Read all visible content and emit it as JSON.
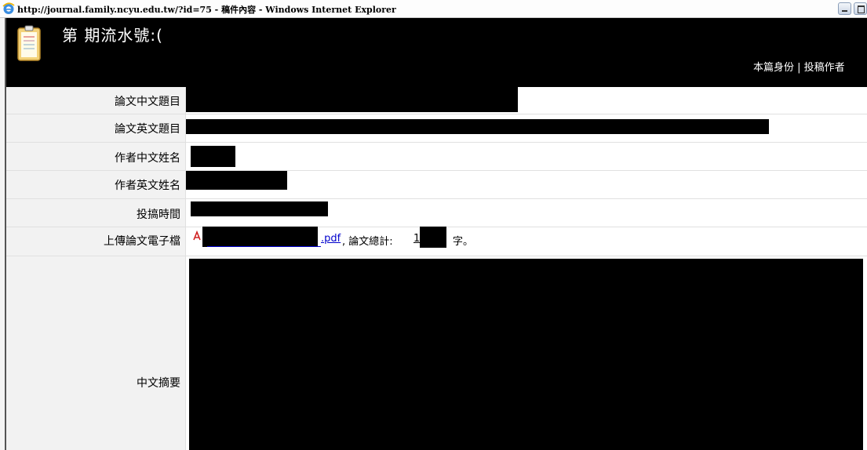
{
  "window": {
    "title": "http://journal.family.ncyu.edu.tw/?id=75 - 稿件內容 - Windows Internet Explorer"
  },
  "header": {
    "issue_text": "第  期流水號:(",
    "right_links": "本篇身份 | 投稿作者"
  },
  "form": {
    "rows": [
      {
        "label": "論文中文題目"
      },
      {
        "label": "論文英文題目"
      },
      {
        "label": "作者中文姓名"
      },
      {
        "label": "作者英文姓名"
      },
      {
        "label": "投搞時間"
      },
      {
        "label": "上傳論文電子檔"
      },
      {
        "label": "中文摘要"
      }
    ],
    "upload": {
      "file_ext": ".pdf",
      "count_label": ", 論文總計:",
      "count_prefix": "1",
      "count_unit": "字。"
    }
  },
  "colors": {
    "header_bg": "#000000",
    "label_bg": "#f2f2f2",
    "link": "#0000cc"
  }
}
